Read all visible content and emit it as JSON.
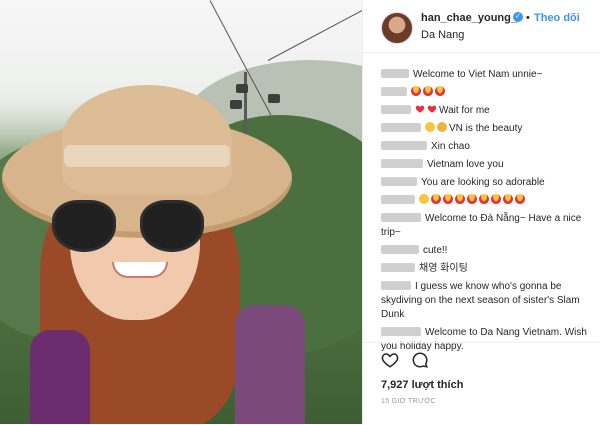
{
  "post": {
    "username": "han_chae_young_",
    "separator": "•",
    "follow_label": "Theo dõi",
    "location": "Da Nang",
    "likes_label": "7,927 lượt thích",
    "timestamp": "15 GIỜ TRƯỚC",
    "verified_glyph": "✓"
  },
  "comments": [
    {
      "text": "Welcome to Viet Nam unnie~",
      "emoji": []
    },
    {
      "text": "",
      "emoji": [
        "heart-eyes",
        "heart-eyes",
        "heart-eyes"
      ]
    },
    {
      "text": "Wait for me",
      "emoji": [
        "heart",
        "heart"
      ]
    },
    {
      "text": "VN is the beauty",
      "emoji": [
        "sweat-smile",
        "wave"
      ]
    },
    {
      "text": "Xin chao",
      "emoji": []
    },
    {
      "text": "Vietnam love you",
      "emoji": []
    },
    {
      "text": "You are looking so adorable",
      "emoji": []
    },
    {
      "text": "",
      "emoji": [
        "kiss",
        "heart-eyes",
        "heart-eyes",
        "heart-eyes",
        "heart-eyes",
        "heart-eyes",
        "heart-eyes",
        "heart-eyes",
        "heart-eyes"
      ]
    },
    {
      "text": "Welcome to Đà Nẵng~ Have a nice trip~",
      "emoji": []
    },
    {
      "text": "cute!!",
      "emoji": []
    },
    {
      "text": "채영 화이팅",
      "emoji": []
    },
    {
      "text": "I guess we know who's gonna be skydiving on the next season of sister's Slam Dunk",
      "emoji": []
    },
    {
      "text": "Welcome to Da Nang Vietnam. Wish you holiday happy.",
      "emoji": []
    }
  ],
  "colors": {
    "accent": "#3897f0",
    "text": "#262626",
    "muted": "#999999",
    "heart": "#ed4956"
  }
}
